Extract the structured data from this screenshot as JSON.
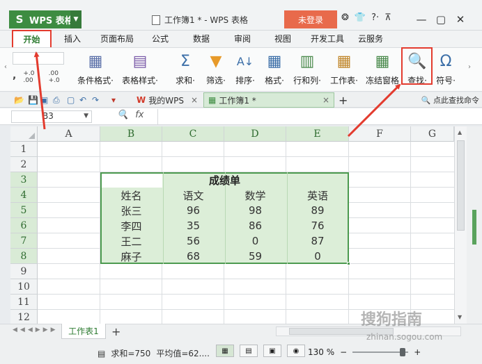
{
  "titlebar": {
    "app_menu": "WPS 表格",
    "document_title": "工作簿1 * - WPS 表格",
    "login_label": "未登录",
    "help_label": "?·",
    "minimize": "—",
    "maximize": "▢",
    "close": "✕"
  },
  "menu": {
    "tabs": [
      "开始",
      "插入",
      "页面布局",
      "公式",
      "数据",
      "审阅",
      "视图",
      "开发工具",
      "云服务"
    ]
  },
  "ribbon": {
    "items": [
      {
        "label": "条件格式·",
        "icon": "conditional-format-icon"
      },
      {
        "label": "表格样式·",
        "icon": "table-style-icon"
      },
      {
        "label": "求和·",
        "icon": "sum-icon"
      },
      {
        "label": "筛选·",
        "icon": "filter-icon"
      },
      {
        "label": "排序·",
        "icon": "sort-icon"
      },
      {
        "label": "格式·",
        "icon": "format-icon"
      },
      {
        "label": "行和列·",
        "icon": "rows-columns-icon"
      },
      {
        "label": "工作表·",
        "icon": "worksheet-icon"
      },
      {
        "label": "冻结窗格",
        "icon": "freeze-panes-icon"
      },
      {
        "label": "查找·",
        "icon": "find-icon"
      },
      {
        "label": "符号·",
        "icon": "symbol-icon"
      }
    ],
    "left_snippets": [
      ",",
      "+.0 .00",
      ".00 +.0"
    ]
  },
  "docbar": {
    "wps_tab": "我的WPS",
    "workbook_tab": "工作簿1 *",
    "find_command": "点此查找命令"
  },
  "formula_bar": {
    "name_box": "B3",
    "fx": "fx"
  },
  "sheet": {
    "columns": [
      "A",
      "B",
      "C",
      "D",
      "E",
      "F",
      "G"
    ],
    "rows": [
      "1",
      "2",
      "3",
      "4",
      "5",
      "6",
      "7",
      "8",
      "9",
      "10",
      "11",
      "12"
    ],
    "table_title": "成绩单",
    "headers": [
      "姓名",
      "语文",
      "数学",
      "英语"
    ],
    "records": [
      [
        "张三",
        "96",
        "98",
        "89"
      ],
      [
        "李四",
        "35",
        "86",
        "76"
      ],
      [
        "王二",
        "56",
        "0",
        "87"
      ],
      [
        "麻子",
        "68",
        "59",
        "0"
      ]
    ]
  },
  "sheet_tabs": {
    "active": "工作表1",
    "add": "+"
  },
  "status": {
    "sum": "求和=750",
    "average": "平均值=62....",
    "zoom": "130 %",
    "zoom_minus": "−",
    "zoom_plus": "+"
  },
  "watermark": {
    "brand": "搜狗指南",
    "url": "zhinan.sogou.com"
  },
  "colors": {
    "accent_green": "#3d8c41",
    "selection_fill": "#dceed8",
    "annotation_red": "#e33b2e",
    "login_orange": "#e86a4b"
  }
}
